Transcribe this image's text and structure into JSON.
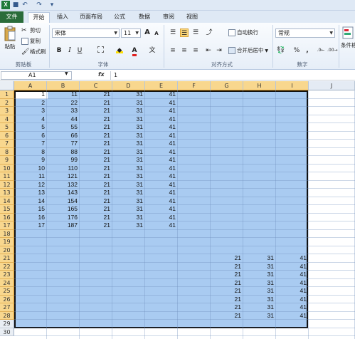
{
  "titlebar": {
    "qat": [
      "save-icon",
      "undo-icon",
      "redo-icon"
    ]
  },
  "tabs": [
    "文件",
    "开始",
    "插入",
    "页面布局",
    "公式",
    "数据",
    "审阅",
    "视图"
  ],
  "ribbon": {
    "clipboard": {
      "paste": "粘贴",
      "cut": "剪切",
      "copy": "复制",
      "format_painter": "格式刷",
      "label": "剪贴板"
    },
    "font": {
      "name": "宋体",
      "size": "11",
      "bold": "B",
      "italic": "I",
      "underline": "U",
      "label": "字体",
      "grow": "A",
      "shrink": "A"
    },
    "alignment": {
      "wrap": "自动换行",
      "merge": "合并后居中",
      "label": "对齐方式"
    },
    "number": {
      "format": "常规",
      "percent": "%",
      "comma": ",",
      "label": "数字"
    },
    "styles": {
      "cond_format": "条件格"
    }
  },
  "formula_bar": {
    "name_box": "A1",
    "fx": "fx",
    "value": "1"
  },
  "columns": [
    "A",
    "B",
    "C",
    "D",
    "E",
    "F",
    "G",
    "H",
    "I",
    "J"
  ],
  "selected_columns": [
    "A",
    "B",
    "C",
    "D",
    "E",
    "F",
    "G",
    "H",
    "I"
  ],
  "rows": [
    "1",
    "2",
    "3",
    "4",
    "5",
    "6",
    "7",
    "8",
    "9",
    "10",
    "11",
    "12",
    "13",
    "14",
    "15",
    "16",
    "17",
    "18",
    "19",
    "20",
    "21",
    "22",
    "23",
    "24",
    "25",
    "26",
    "27",
    "28",
    "29",
    "30"
  ],
  "cells": [
    [
      "1",
      "11",
      "21",
      "31",
      "41"
    ],
    [
      "2",
      "22",
      "21",
      "31",
      "41"
    ],
    [
      "3",
      "33",
      "21",
      "31",
      "41"
    ],
    [
      "4",
      "44",
      "21",
      "31",
      "41"
    ],
    [
      "5",
      "55",
      "21",
      "31",
      "41"
    ],
    [
      "6",
      "66",
      "21",
      "31",
      "41"
    ],
    [
      "7",
      "77",
      "21",
      "31",
      "41"
    ],
    [
      "8",
      "88",
      "21",
      "31",
      "41"
    ],
    [
      "9",
      "99",
      "21",
      "31",
      "41"
    ],
    [
      "10",
      "110",
      "21",
      "31",
      "41"
    ],
    [
      "11",
      "121",
      "21",
      "31",
      "41"
    ],
    [
      "12",
      "132",
      "21",
      "31",
      "41"
    ],
    [
      "13",
      "143",
      "21",
      "31",
      "41"
    ],
    [
      "14",
      "154",
      "21",
      "31",
      "41"
    ],
    [
      "15",
      "165",
      "21",
      "31",
      "41"
    ],
    [
      "16",
      "176",
      "21",
      "31",
      "41"
    ],
    [
      "17",
      "187",
      "21",
      "31",
      "41"
    ]
  ],
  "cells_lower": [
    [
      "21",
      "31",
      "41"
    ],
    [
      "21",
      "31",
      "41"
    ],
    [
      "21",
      "31",
      "41"
    ],
    [
      "21",
      "31",
      "41"
    ],
    [
      "21",
      "31",
      "41"
    ],
    [
      "21",
      "31",
      "41"
    ],
    [
      "21",
      "31",
      "41"
    ],
    [
      "21",
      "31",
      "41"
    ]
  ]
}
